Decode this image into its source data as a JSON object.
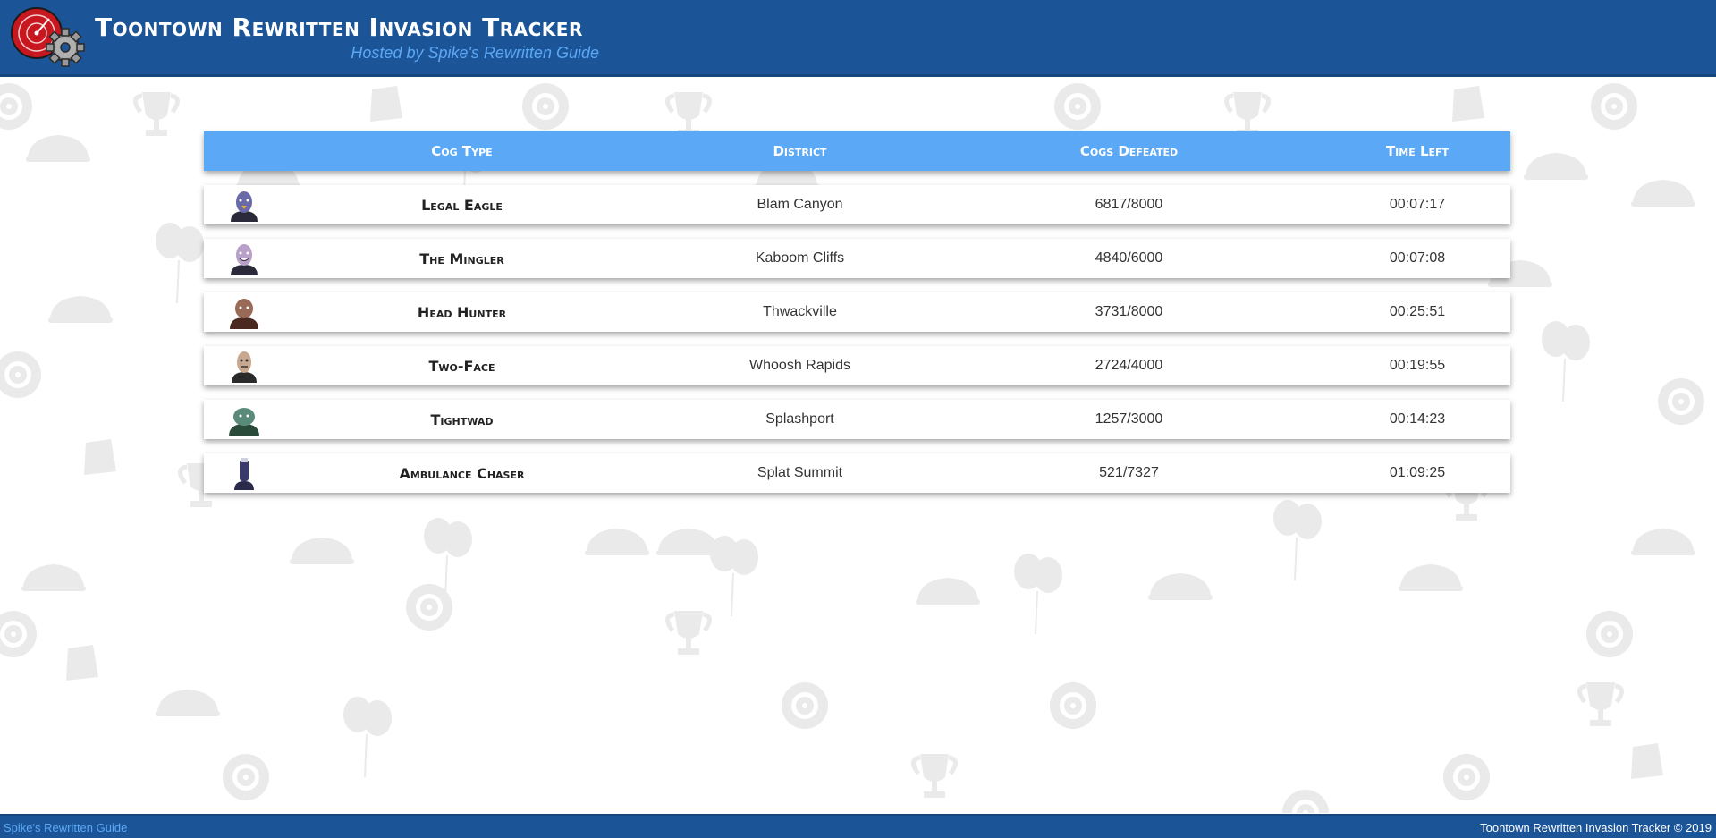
{
  "header": {
    "title": "Toontown Rewritten Invasion Tracker",
    "subtitle": "Hosted by Spike's Rewritten Guide",
    "logo_icon": "radar-gear-icon"
  },
  "table": {
    "columns": [
      "Cog Type",
      "District",
      "Cogs Defeated",
      "Time Left"
    ],
    "rows": [
      {
        "cog": "Legal Eagle",
        "district": "Blam Canyon",
        "defeated": "6817/8000",
        "time_left": "00:07:17",
        "avatar_color": "#6b6aa8"
      },
      {
        "cog": "The Mingler",
        "district": "Kaboom Cliffs",
        "defeated": "4840/6000",
        "time_left": "00:07:08",
        "avatar_color": "#b8a0c8"
      },
      {
        "cog": "Head Hunter",
        "district": "Thwackville",
        "defeated": "3731/8000",
        "time_left": "00:25:51",
        "avatar_color": "#9a6a58"
      },
      {
        "cog": "Two-Face",
        "district": "Whoosh Rapids",
        "defeated": "2724/4000",
        "time_left": "00:19:55",
        "avatar_color": "#c8a890"
      },
      {
        "cog": "Tightwad",
        "district": "Splashport",
        "defeated": "1257/3000",
        "time_left": "00:14:23",
        "avatar_color": "#5a8a7a"
      },
      {
        "cog": "Ambulance Chaser",
        "district": "Splat Summit",
        "defeated": "521/7327",
        "time_left": "01:09:25",
        "avatar_color": "#3a3a6a"
      }
    ]
  },
  "footer": {
    "link_label": "Spike's Rewritten Guide",
    "copyright": "Toontown Rewritten Invasion Tracker © 2019"
  },
  "colors": {
    "header_bg": "#1c5597",
    "accent": "#5aa8f6"
  }
}
